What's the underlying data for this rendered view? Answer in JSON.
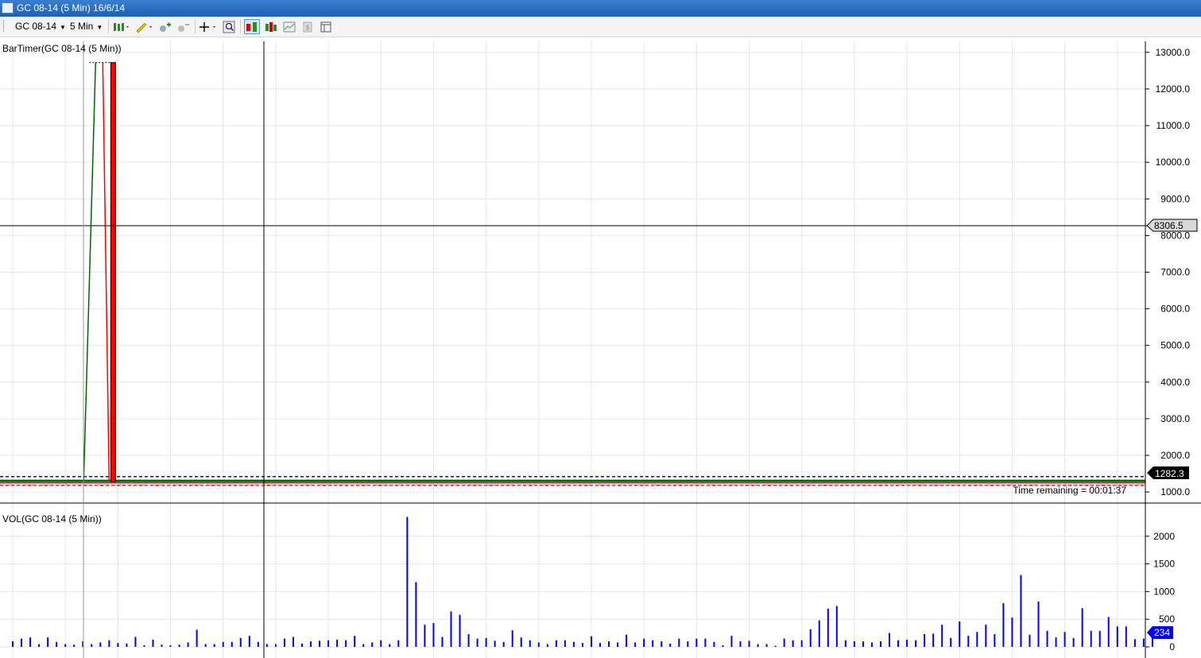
{
  "window": {
    "title": "GC 08-14 (5 Min)  16/6/14"
  },
  "toolbar": {
    "instrument": "GC 08-14",
    "interval": "5 Min",
    "buttons": [
      "bar-type-icon",
      "pencil-draw-icon",
      "zoom-in-icon",
      "zoom-out-icon",
      "crosshair-icon",
      "search-icon",
      "chart-trader-icon",
      "data-series-icon",
      "indicators-icon",
      "strategies-icon",
      "properties-icon"
    ]
  },
  "colors": {
    "up": "#006400",
    "down": "#ff0000",
    "volume": "#0000ff",
    "grid": "#e6e6e6",
    "price_marker": "#000000",
    "volume_marker": "#0000ff",
    "bid_line": "#0000ff",
    "ask_line": "#ff0000"
  },
  "chart_data": [
    {
      "type": "line",
      "title": "BarTimer(GC 08-14 (5 Min))",
      "xlabel": "",
      "ylabel": "",
      "ylim": [
        720,
        13300
      ],
      "yticks": [
        1000,
        2000,
        3000,
        4000,
        5000,
        6000,
        7000,
        8000,
        9000,
        10000,
        11000,
        12000,
        13000
      ],
      "ytick_labels": [
        "1000.0",
        "2000.0",
        "3000.0",
        "4000.0",
        "5000.0",
        "6000.0",
        "7000.0",
        "8000.0",
        "9000.0",
        "10000.0",
        "11000.0",
        "12000.0",
        "13000.0"
      ],
      "bars": 131,
      "close_level": 1282.3,
      "spike": [
        {
          "bar": 8,
          "open": 1282.3,
          "close": 12720,
          "direction": "up"
        },
        {
          "bar": 10,
          "open": 12720,
          "close": 1282.3,
          "direction": "up"
        },
        {
          "bar": 11,
          "open": 12720,
          "close": 1282.3,
          "direction": "down"
        }
      ],
      "bid_level": 1420,
      "ask_level": 1180,
      "crosshair_price": "8306.5",
      "last_price_label": "1282.3",
      "status_text": "Time remaining = 00:01:37",
      "grid": true
    },
    {
      "type": "bar",
      "title": "VOL(GC 08-14 (5 Min))",
      "xlabel": "",
      "ylabel": "",
      "ylim": [
        0,
        2500
      ],
      "yticks": [
        0,
        500,
        1000,
        1500,
        2000
      ],
      "ytick_labels": [
        "0",
        "500",
        "1000",
        "1500",
        "2000"
      ],
      "values": [
        100,
        150,
        170,
        50,
        170,
        90,
        50,
        40,
        100,
        50,
        80,
        120,
        70,
        60,
        180,
        30,
        130,
        40,
        30,
        40,
        80,
        310,
        50,
        50,
        90,
        90,
        160,
        200,
        90,
        50,
        50,
        150,
        180,
        60,
        100,
        110,
        120,
        130,
        120,
        200,
        50,
        80,
        120,
        50,
        120,
        2350,
        1170,
        400,
        430,
        180,
        640,
        580,
        230,
        150,
        160,
        110,
        90,
        300,
        170,
        120,
        80,
        50,
        120,
        120,
        90,
        70,
        190,
        70,
        100,
        80,
        220,
        80,
        150,
        120,
        100,
        60,
        150,
        100,
        150,
        150,
        90,
        30,
        200,
        100,
        110,
        50,
        50,
        20,
        150,
        120,
        120,
        320,
        480,
        690,
        740,
        120,
        100,
        100,
        80,
        100,
        250,
        120,
        130,
        120,
        230,
        240,
        400,
        160,
        460,
        200,
        270,
        400,
        230,
        790,
        530,
        1300,
        220,
        820,
        290,
        170,
        270,
        160,
        700,
        290,
        290,
        540,
        370,
        370,
        140,
        150,
        234
      ],
      "last_volume_label": "234",
      "grid": true
    }
  ]
}
